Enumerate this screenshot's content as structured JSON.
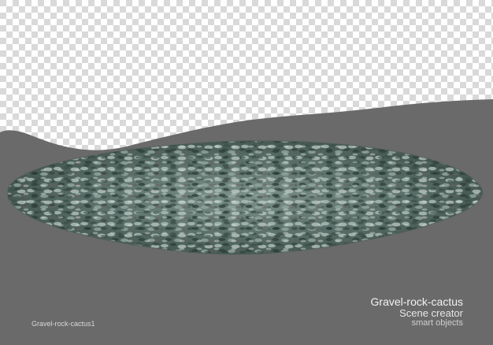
{
  "image": {
    "caption": "Gravel-rock-cactus1",
    "brand": {
      "title": "Gravel-rock-cactus",
      "subtitle": "Scene creator",
      "tagline": "smart objects"
    }
  },
  "colors": {
    "background_gray": "#6a6a6a",
    "checker_light": "#ffffff",
    "checker_dark": "#d9d9d9",
    "gravel_dark": "#31423d",
    "gravel_mid": "#5e746e",
    "gravel_light": "#9fb2ab"
  }
}
